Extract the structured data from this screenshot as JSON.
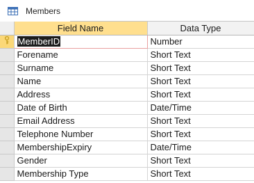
{
  "tab": {
    "title": "Members",
    "icon": "table-icon"
  },
  "columns": {
    "field_name": "Field Name",
    "data_type": "Data Type"
  },
  "rows": [
    {
      "field": "MemberID",
      "type": "Number",
      "primary_key": true
    },
    {
      "field": "Forename",
      "type": "Short Text"
    },
    {
      "field": "Surname",
      "type": "Short Text"
    },
    {
      "field": "Name",
      "type": "Short Text"
    },
    {
      "field": "Address",
      "type": "Short Text"
    },
    {
      "field": "Date of Birth",
      "type": "Date/Time"
    },
    {
      "field": "Email Address",
      "type": "Short Text"
    },
    {
      "field": "Telephone Number",
      "type": "Short Text"
    },
    {
      "field": "MembershipExpiry",
      "type": "Date/Time"
    },
    {
      "field": "Gender",
      "type": "Short Text"
    },
    {
      "field": "Membership Type",
      "type": "Short Text"
    }
  ],
  "colors": {
    "header_highlight": "#ffdf8e",
    "selector_active": "#fbd878",
    "key_icon": "#c9a227"
  }
}
